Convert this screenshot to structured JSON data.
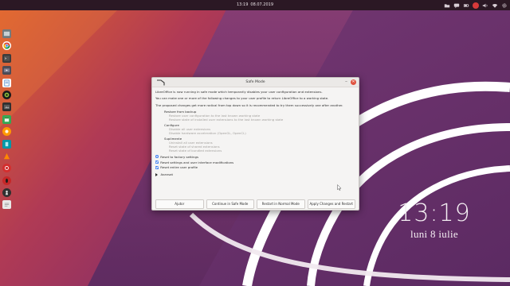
{
  "top_bar": {
    "time": "13:19",
    "date": "08.07.2019",
    "tray_icons": [
      "folder-icon",
      "chat-icon",
      "battery-icon",
      "notification-badge",
      "volume-icon",
      "wifi-icon",
      "settings-icon"
    ]
  },
  "dock": {
    "items": [
      "file-manager",
      "chrome",
      "terminal",
      "video-editor",
      "libreoffice-writer",
      "gnome-tweaks",
      "image-viewer",
      "orange-app",
      "calendar",
      "teal-app",
      "vlc",
      "red-app",
      "opera",
      "chess",
      "text-editor"
    ]
  },
  "desktop_clock": {
    "time": "13:19",
    "date": "luni  8 iulie"
  },
  "dialog": {
    "title": "Safe Mode",
    "intro": "LibreOffice is now running in safe mode which temporarily disables your user configuration and extensions.",
    "instruction": "You can make one or more of the following changes to your user profile to return LibreOffice to a working state.",
    "note": "The proposed changes get more radical from top down so it is recommended to try them successively one after another.",
    "restore_group": {
      "label": "Restore from backup",
      "options": [
        "Restore user configuration to the last known working state",
        "Restore state of installed user extensions to the last known working state"
      ]
    },
    "configure_group": {
      "label": "Configure",
      "options": [
        "Disable all user extensions",
        "Disable hardware acceleration (OpenGL, OpenCL)"
      ]
    },
    "deinstall_group": {
      "label": "Suplimente",
      "options": [
        "Uninstall all user extensions",
        "Reset state of shared extensions",
        "Reset state of bundled extensions"
      ]
    },
    "reset_radio": "Reset to factory settings",
    "reset_options": [
      "Reset settings and user interface modifications",
      "Reset entire user profile"
    ],
    "advanced": "Avansat",
    "buttons": {
      "help": "Ajutor",
      "continue": "Continue in Safe Mode",
      "restart": "Restart in Normal Mode",
      "apply": "Apply Changes and Restart"
    }
  },
  "colors": {
    "accent": "#3f7ff0",
    "panel": "#2b1824",
    "close": "#e0523f"
  }
}
